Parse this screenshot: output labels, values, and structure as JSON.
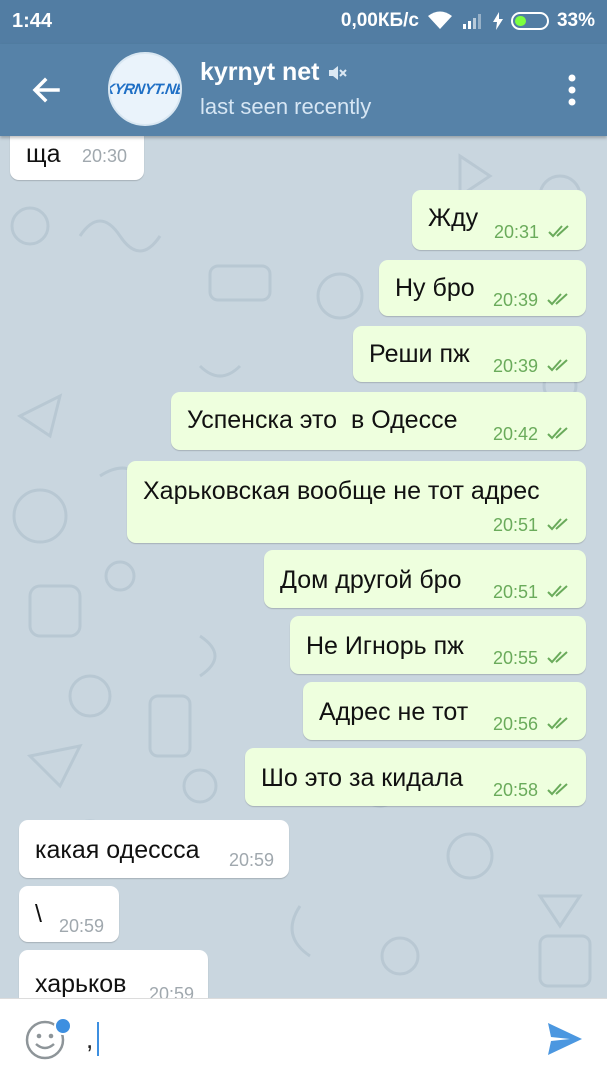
{
  "statusbar": {
    "time": "1:44",
    "speed": "0,00КБ/с",
    "battery": "33%",
    "icons": [
      "wifi-icon",
      "signal-icon",
      "charging-icon",
      "battery-icon"
    ]
  },
  "header": {
    "title": "kyrnyt net",
    "subtitle": "last seen recently",
    "avatar_text": "KYRNYT.NE",
    "icons": [
      "back-arrow-icon",
      "muted-icon",
      "more-vert-icon"
    ]
  },
  "messages": [
    {
      "dir": "in",
      "text": "ща",
      "time": "20:30"
    },
    {
      "dir": "out",
      "text": "Жду",
      "time": "20:31",
      "read": true
    },
    {
      "dir": "out",
      "text": "Ну бро",
      "time": "20:39",
      "read": true
    },
    {
      "dir": "out",
      "text": "Реши пж",
      "time": "20:39",
      "read": true
    },
    {
      "dir": "out",
      "text": "Успенска это  в Одессе",
      "time": "20:42",
      "read": true
    },
    {
      "dir": "out",
      "text": "Харьковская вообще не тот адрес",
      "time": "20:51",
      "read": true
    },
    {
      "dir": "out",
      "text": "Дом другой бро",
      "time": "20:51",
      "read": true
    },
    {
      "dir": "out",
      "text": "Не Игнорь пж",
      "time": "20:55",
      "read": true
    },
    {
      "dir": "out",
      "text": "Адрес не тот",
      "time": "20:56",
      "read": true
    },
    {
      "dir": "out",
      "text": "Шо это за кидала",
      "time": "20:58",
      "read": true
    },
    {
      "dir": "in",
      "text": "какая одессса",
      "time": "20:59"
    },
    {
      "dir": "in",
      "text": "\\",
      "time": "20:59"
    },
    {
      "dir": "in",
      "text": "харьков",
      "time": "20:59"
    }
  ],
  "composer": {
    "value": ",",
    "icons": [
      "emoji-icon",
      "send-icon"
    ]
  },
  "colors": {
    "header": "#5682a8",
    "statusbar": "#527da3",
    "outgoing_bubble": "#eeffde",
    "incoming_bubble": "#ffffff",
    "chat_bg": "#c9d6df",
    "check": "#6aab5b",
    "accent": "#3d8fe0"
  }
}
